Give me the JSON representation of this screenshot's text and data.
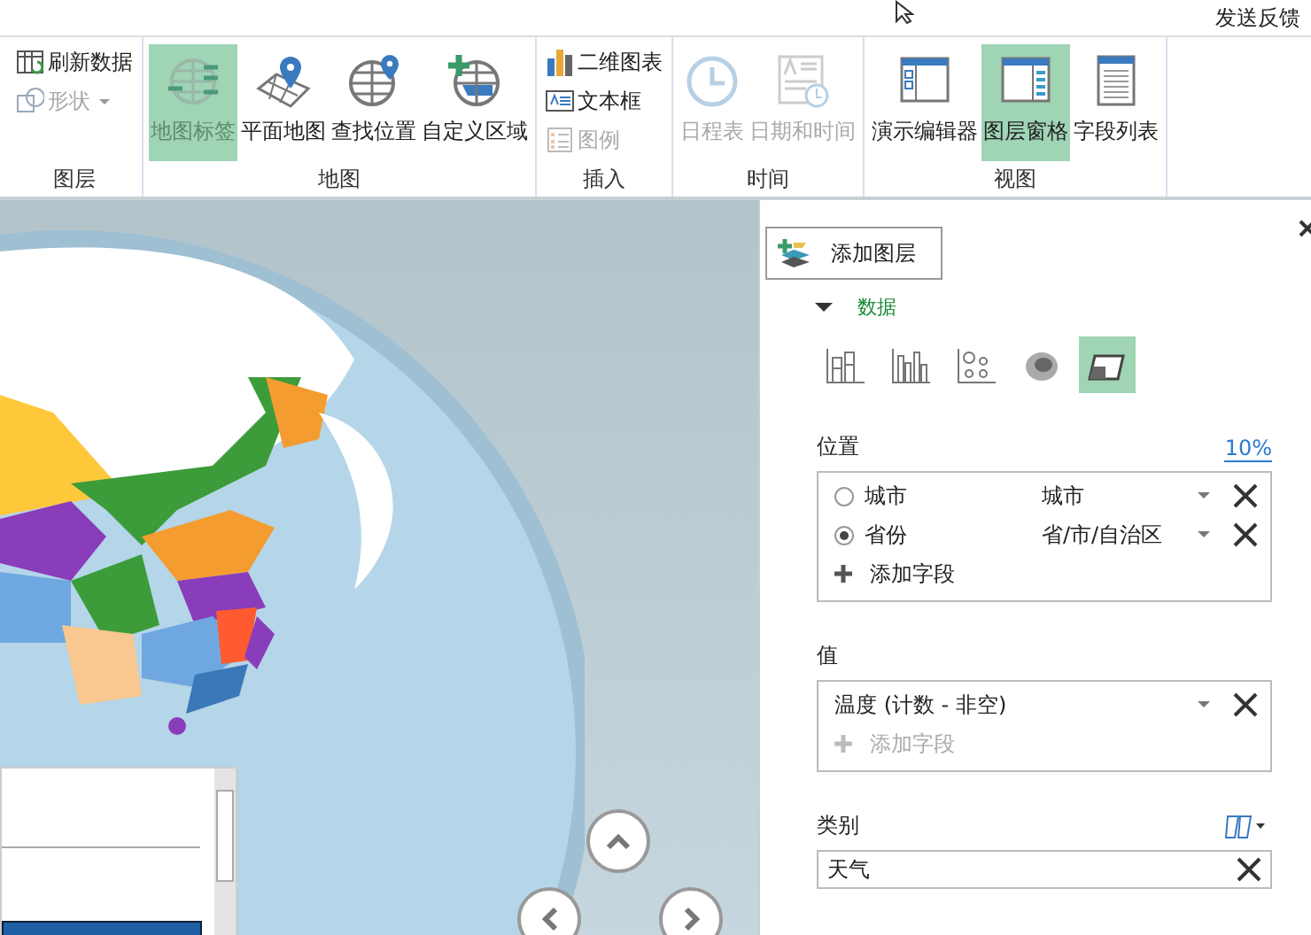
{
  "top_bar": {
    "feedback": "发送反馈"
  },
  "ribbon": {
    "groups": [
      {
        "label": "图层",
        "buttons": [
          {
            "label": "刷新数据",
            "kind": "small",
            "selected": false,
            "disabled": false
          },
          {
            "label": "形状",
            "kind": "menu",
            "selected": false,
            "disabled": true
          }
        ]
      },
      {
        "label": "地图",
        "buttons": [
          {
            "label": "地图标签",
            "kind": "large",
            "selected": true,
            "disabled": true
          },
          {
            "label": "平面地图",
            "kind": "large",
            "selected": false,
            "disabled": false
          },
          {
            "label": "查找位置",
            "kind": "large",
            "selected": false,
            "disabled": false
          },
          {
            "label": "自定义区域",
            "kind": "large",
            "selected": false,
            "disabled": false
          }
        ]
      },
      {
        "label": "插入",
        "buttons": [
          {
            "label": "二维图表",
            "kind": "small",
            "selected": false,
            "disabled": false
          },
          {
            "label": "文本框",
            "kind": "small",
            "selected": false,
            "disabled": false
          },
          {
            "label": "图例",
            "kind": "small",
            "selected": false,
            "disabled": true
          }
        ]
      },
      {
        "label": "时间",
        "buttons": [
          {
            "label": "日程表",
            "kind": "large",
            "selected": false,
            "disabled": true
          },
          {
            "label": "日期和时间",
            "kind": "large",
            "selected": false,
            "disabled": true
          }
        ]
      },
      {
        "label": "视图",
        "buttons": [
          {
            "label": "演示编辑器",
            "kind": "large",
            "selected": false,
            "disabled": false
          },
          {
            "label": "图层窗格",
            "kind": "large",
            "selected": true,
            "disabled": false
          },
          {
            "label": "字段列表",
            "kind": "large",
            "selected": false,
            "disabled": false
          }
        ]
      }
    ]
  },
  "layer_pane": {
    "add_layer_button": "添加图层",
    "section": {
      "title": "数据",
      "expanded": true
    },
    "chart_types": [
      {
        "selected": false
      },
      {
        "selected": false
      },
      {
        "selected": false
      },
      {
        "selected": false
      },
      {
        "selected": true
      }
    ],
    "location": {
      "label": "位置",
      "link": "10%",
      "fields": [
        {
          "name": "城市",
          "value": "城市",
          "selected": false
        },
        {
          "name": "省份",
          "value": "省/市/自治区",
          "selected": true
        }
      ],
      "add_field": {
        "label": "添加字段",
        "disabled": false
      }
    },
    "values": {
      "label": "值",
      "fields": [
        {
          "name": "温度 (计数 - 非空)"
        }
      ],
      "add_field": {
        "label": "添加字段",
        "disabled": true
      }
    },
    "category": {
      "label": "类别",
      "value": "天气"
    }
  }
}
